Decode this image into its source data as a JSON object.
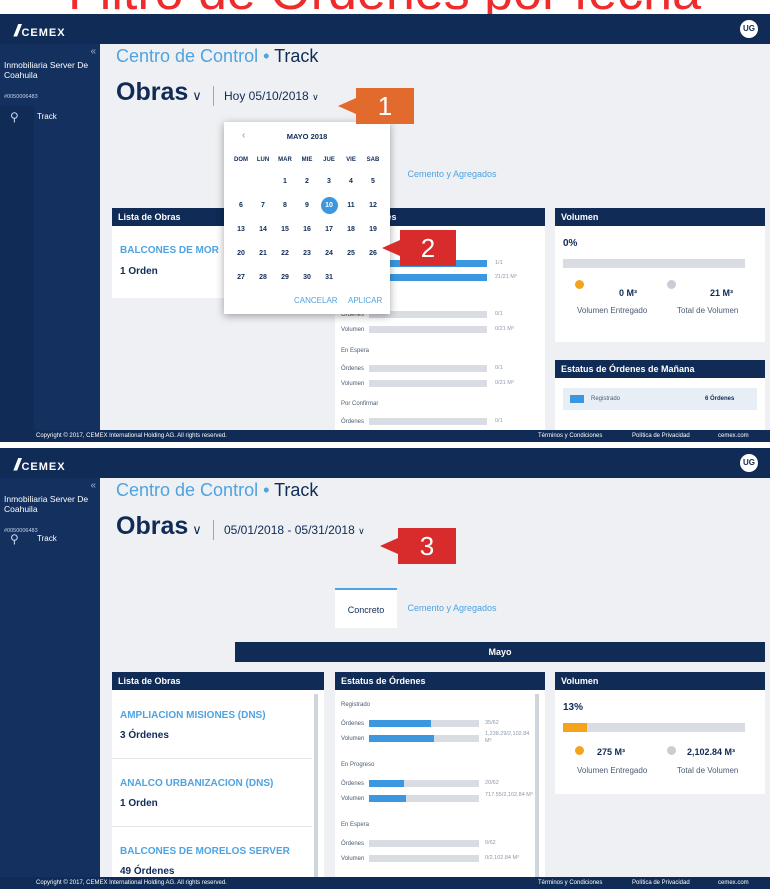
{
  "slide": {
    "title": "Filtro de Órdenes por fecha"
  },
  "app": {
    "brand": "CEMEX",
    "user_initials": "UG"
  },
  "sidebar": {
    "company": "Inmobiliaria Server De Coahuila",
    "account": "#0050006483",
    "nav": [
      {
        "label": "Track",
        "icon": "location-pin-icon"
      }
    ]
  },
  "header": {
    "section": "Centro de Control",
    "separator": "•",
    "subsection": "Track",
    "page_title": "Obras"
  },
  "tabs": [
    {
      "label": "Concreto",
      "active": true
    },
    {
      "label": "Cemento y Agregados",
      "active": false
    }
  ],
  "footer": {
    "copyright": "Copyright © 2017, CEMEX International Holding AG. All rights reserved.",
    "links": [
      "Términos y Condiciones",
      "Política de Privacidad",
      "cemex.com"
    ]
  },
  "panel1": {
    "date_selector": "Hoy 05/10/2018",
    "calendar": {
      "month": "MAYO 2018",
      "weekdays": [
        "DOM",
        "LUN",
        "MAR",
        "MIE",
        "JUE",
        "VIE",
        "SAB"
      ],
      "weeks": [
        [
          "",
          "",
          "1",
          "2",
          "3",
          "4",
          "5"
        ],
        [
          "6",
          "7",
          "8",
          "9",
          "10",
          "11",
          "12"
        ],
        [
          "13",
          "14",
          "15",
          "16",
          "17",
          "18",
          "19"
        ],
        [
          "20",
          "21",
          "22",
          "23",
          "24",
          "25",
          "26"
        ],
        [
          "27",
          "28",
          "29",
          "30",
          "31",
          "",
          ""
        ]
      ],
      "selected_day": "10",
      "cancel": "CANCELAR",
      "apply": "APLICAR"
    },
    "lista_obras": {
      "header": "Lista de Obras",
      "items": [
        {
          "name": "BALCONES DE MOR",
          "count": "1 Orden"
        }
      ]
    },
    "estatus": {
      "header": "rdenes",
      "top_vals": [
        "1/1",
        "21/21 M³"
      ],
      "groups": [
        {
          "label": "",
          "ordenes": "0/1",
          "volumen": "0/21 M³",
          "ord_fill": 0,
          "vol_fill": 0
        },
        {
          "label": "En Espera",
          "ordenes": "0/1",
          "volumen": "0/21 M³",
          "ord_fill": 0,
          "vol_fill": 0
        },
        {
          "label": "Por Confirmar",
          "ordenes": "0/1",
          "volumen": "0/21 M³",
          "ord_fill": 0,
          "vol_fill": 0
        }
      ],
      "ordenes_label": "Órdenes",
      "volumen_label": "Volumen"
    },
    "volumen": {
      "header": "Volumen",
      "percent": "0%",
      "entregado": "0 M³",
      "total": "21 M³",
      "entregado_label": "Volumen Entregado",
      "total_label": "Total de Volumen",
      "fill": 0
    },
    "manana": {
      "header": "Estatus de Órdenes de Mañana",
      "legend": "Registrado",
      "count": "6 Órdenes"
    }
  },
  "panel2": {
    "date_selector": "05/01/2018 - 05/31/2018",
    "month_band": "Mayo",
    "lista_obras": {
      "header": "Lista de Obras",
      "items": [
        {
          "name": "AMPLIACION MISIONES (DNS)",
          "count": "3 Órdenes"
        },
        {
          "name": "ANALCO URBANIZACION (DNS)",
          "count": "1 Orden"
        },
        {
          "name": "BALCONES DE MORELOS SERVER",
          "count": "49 Órdenes"
        }
      ]
    },
    "estatus": {
      "header": "Estatus de Órdenes",
      "ordenes_label": "Órdenes",
      "volumen_label": "Volumen",
      "groups": [
        {
          "label": "Registrado",
          "ordenes": "35/62",
          "volumen": "1,238.29/2,102.84 M³",
          "ord_fill": 0.56,
          "vol_fill": 0.59
        },
        {
          "label": "En Progreso",
          "ordenes": "20/62",
          "volumen": "717.55/2,102.84 M³",
          "ord_fill": 0.32,
          "vol_fill": 0.34
        },
        {
          "label": "En Espera",
          "ordenes": "0/62",
          "volumen": "0/2,102.84 M³",
          "ord_fill": 0,
          "vol_fill": 0
        }
      ]
    },
    "volumen": {
      "header": "Volumen",
      "percent": "13%",
      "entregado": "275 M³",
      "total": "2,102.84 M³",
      "entregado_label": "Volumen Entregado",
      "total_label": "Total de Volumen",
      "fill": 0.13
    }
  },
  "callouts": [
    "1",
    "2",
    "3"
  ],
  "colors": {
    "navy": "#0f2b56",
    "accent_blue": "#4fa3e0",
    "bar_blue": "#3b97e0",
    "orange": "#f4a41c",
    "callout_orange": "#e26a2c",
    "callout_red": "#d82c2c",
    "title_red": "#ef2b2b"
  }
}
